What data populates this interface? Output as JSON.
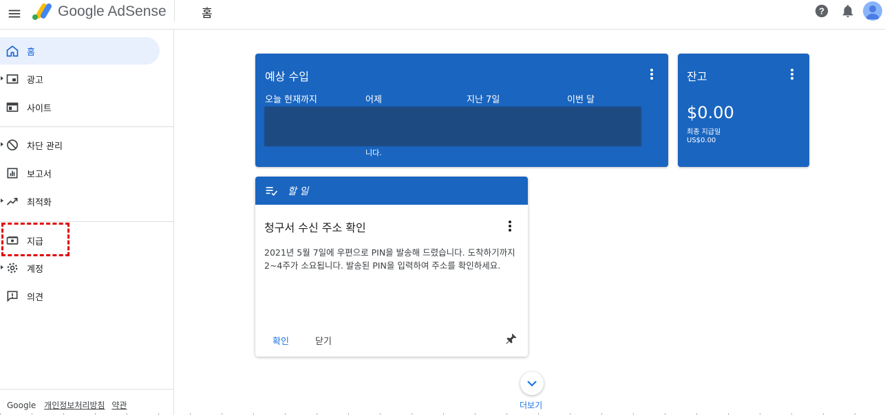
{
  "app": {
    "brand": "Google AdSense",
    "page_title": "홈"
  },
  "colors": {
    "accent": "#1a65c0",
    "active_bg": "#e8f0fe",
    "highlight": "#e00000"
  },
  "sidebar": {
    "items": [
      {
        "label": "홈",
        "icon": "home-icon"
      },
      {
        "label": "광고",
        "icon": "ads-icon"
      },
      {
        "label": "사이트",
        "icon": "sites-icon"
      },
      {
        "label": "차단 관리",
        "icon": "block-icon"
      },
      {
        "label": "보고서",
        "icon": "reports-icon"
      },
      {
        "label": "최적화",
        "icon": "optimize-icon"
      },
      {
        "label": "지급",
        "icon": "payments-icon"
      },
      {
        "label": "계정",
        "icon": "gear-icon"
      },
      {
        "label": "의견",
        "icon": "feedback-icon"
      }
    ],
    "footer": {
      "google": "Google",
      "privacy": "개인정보처리방침",
      "terms": "약관"
    }
  },
  "earnings": {
    "title": "예상 수입",
    "columns": [
      "오늘 현재까지",
      "어제",
      "지난 7일",
      "이번 달"
    ],
    "tail": "니다."
  },
  "balance": {
    "title": "잔고",
    "amount": "$0.00",
    "label": "최종 지급일",
    "sub": "US$0.00"
  },
  "todo": {
    "header": "할 일",
    "title": "청구서 수신 주소 확인",
    "body_line1": "2021년 5월 7일에 우편으로 PIN을 발송해 드렸습니다. 도착하기까지",
    "body_line2": "2~4주가 소요됩니다. 발송된 PIN을 입력하여 주소를 확인하세요.",
    "confirm": "확인",
    "close": "닫기"
  },
  "more": {
    "label": "더보기"
  }
}
